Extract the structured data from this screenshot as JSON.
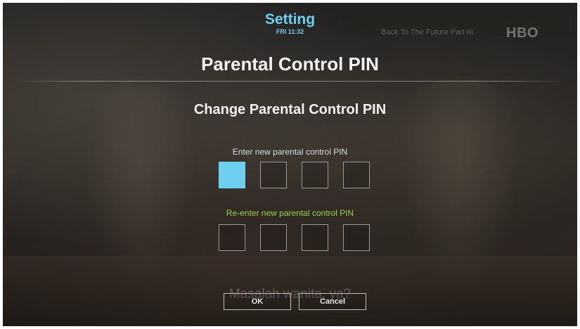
{
  "header": {
    "title": "Setting",
    "time": "FRI 11:32"
  },
  "program": {
    "title": "Back To The Future Part III",
    "channel_logo": "HBO"
  },
  "page": {
    "title": "Parental Control PIN",
    "section_title": "Change Parental Control PIN"
  },
  "new_pin": {
    "label": "Enter new parental control PIN",
    "digits": 4,
    "active_index": 0
  },
  "reenter_pin": {
    "label": "Re-enter new parental control PIN",
    "digits": 4
  },
  "background": {
    "subtitle": "Masalah wanita, ya?"
  },
  "buttons": {
    "ok": "OK",
    "cancel": "Cancel"
  },
  "colors": {
    "accent": "#6ed0f0",
    "reenter_label": "#9bd04a"
  }
}
